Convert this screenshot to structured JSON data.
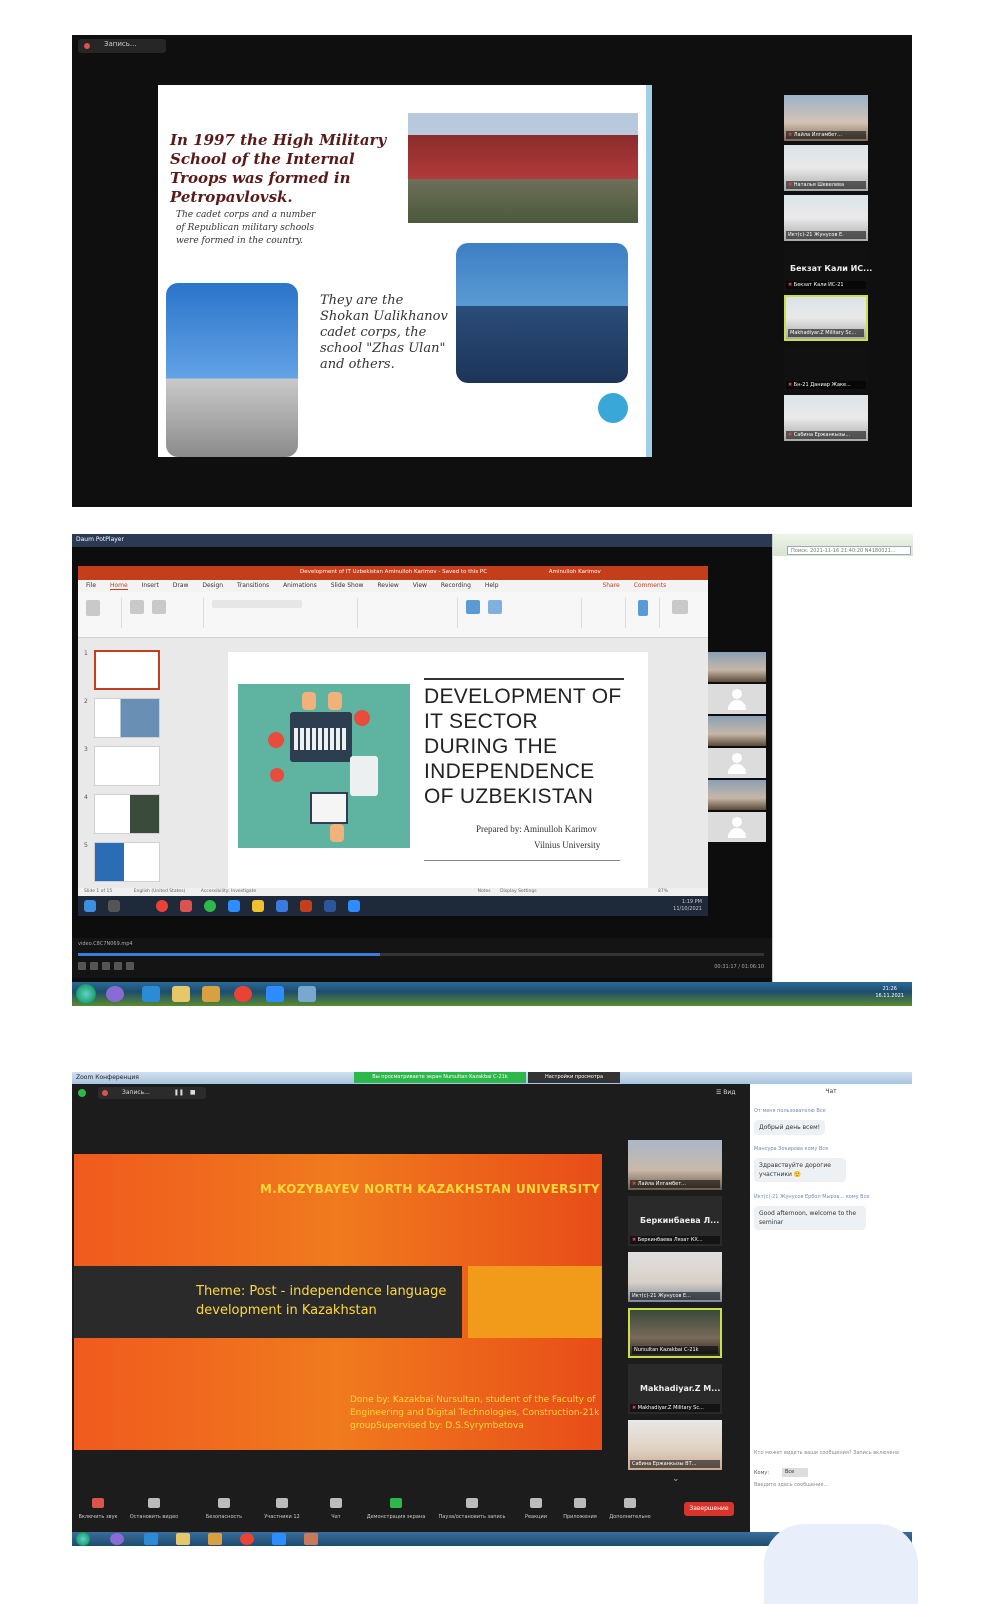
{
  "panel1": {
    "record_label": "Запись...",
    "slide": {
      "title": "In 1997 the High Military School of the Internal Troops was formed in Petropavlovsk.",
      "text1": "The cadet corps and a number of Republican military schools were formed in the country.",
      "text2": "They are the Shokan Ualikhanov cadet corps, the school \"Zhas Ulan\" and others."
    },
    "participants": [
      {
        "name": "Лайла Илгамбет..."
      },
      {
        "name": "Наталья Шевелева"
      },
      {
        "name": "Икт(с)-21 Жунусов Е."
      },
      {
        "name": "Бекзат Кали ИС...",
        "sub": "Бекзат Кали ИС-21"
      },
      {
        "name": "Makhadiyar.Z Military Sc..."
      },
      {
        "name": "Бн-21 Даниар Жаке..."
      },
      {
        "name": "Сабина Ержанкызы..."
      }
    ]
  },
  "panel2": {
    "window_title": "Daum PotPlayer",
    "ppt_title": "Development of IT Uzbekistan Aminulloh Karimov - Saved to this PC",
    "ppt_user": "Aminulloh Karimov",
    "menu": [
      "File",
      "Home",
      "Insert",
      "Draw",
      "Design",
      "Transitions",
      "Animations",
      "Slide Show",
      "Review",
      "View",
      "Recording",
      "Help"
    ],
    "share": "Share",
    "comments": "Comments",
    "slide_title": "DEVELOPMENT OF IT SECTOR DURING THE INDEPENDENCE OF UZBEKISTAN",
    "prepared_by": "Prepared by: Aminulloh Karimov",
    "university": "Vilnius University",
    "slide_count": "Slide 1 of 15",
    "status_lang": "English (United States)",
    "accessibility": "Accessibility: Investigate",
    "notes": "Notes",
    "display": "Display Settings",
    "zoom": "87%",
    "task_time": "1:19 PM",
    "task_date": "11/10/2021",
    "player_file": "video.C8C7N069.mp4",
    "player_time": "00:31:17 / 01:06:10",
    "win7_time": "21:26",
    "win7_date": "16.11.2021",
    "search_text": "Поиск: 2021-11-16 21:40:20 N4180021..."
  },
  "panel3": {
    "window_title": "Zoom Конференция",
    "share_banner": "Вы просматриваете экран Nursultan Kazakbai C-21k",
    "view_options": "Настройки просмотра",
    "record_label": "Запись...",
    "view_label": "Вид",
    "slide": {
      "university": "M.KOZYBAYEV NORTH KAZAKHSTAN UNIVERSITY",
      "theme": "Theme: Post - independence language development in Kazakhstan",
      "done_by": "Done by: Kazakbai Nursultan, student of the Faculty of Engineering and Digital Technologies, Construction-21k groupSupervised by: D.S.Syrymbetova"
    },
    "participants": [
      {
        "name": "Лайла Илгамбет..."
      },
      {
        "name": "Беркинбаева Л...",
        "sub": "Беркинбаева Лязат КХ..."
      },
      {
        "name": "Икт(с)-21 Жунусов Е..."
      },
      {
        "name": "Nursultan Kazakbai C-21k"
      },
      {
        "name": "Makhadiyar.Z M...",
        "sub": "Makhadiyar.Z Military Sc..."
      },
      {
        "name": "Сабина Ержанкызы ВТ..."
      }
    ],
    "toolbar": [
      {
        "label": "Включить звук"
      },
      {
        "label": "Остановить видео"
      },
      {
        "label": "Безопасность"
      },
      {
        "label": "Участники",
        "count": "12"
      },
      {
        "label": "Чат"
      },
      {
        "label": "Демонстрация экрана"
      },
      {
        "label": "Пауза/остановить запись"
      },
      {
        "label": "Реакции"
      },
      {
        "label": "Приложения"
      },
      {
        "label": "Дополнительно"
      }
    ],
    "end_label": "Завершение",
    "chat": {
      "title": "Чат",
      "messages": [
        {
          "from": "От меня пользователю Все",
          "text": "Добрый день всем!"
        },
        {
          "from": "Мансура Зокирова кому Все",
          "text": "Здравствуйте дорогие участники 🙂"
        },
        {
          "from": "Икт(с)-21 Жунусов Ербол Мырза... кому Все",
          "text": "Good afternoon, welcome to the seminar"
        }
      ],
      "who_can_see": "Кто может видеть ваши сообщения? Запись включена",
      "to_label": "Кому:",
      "to_value": "Все",
      "input_placeholder": "Введите здесь сообщение..."
    }
  }
}
